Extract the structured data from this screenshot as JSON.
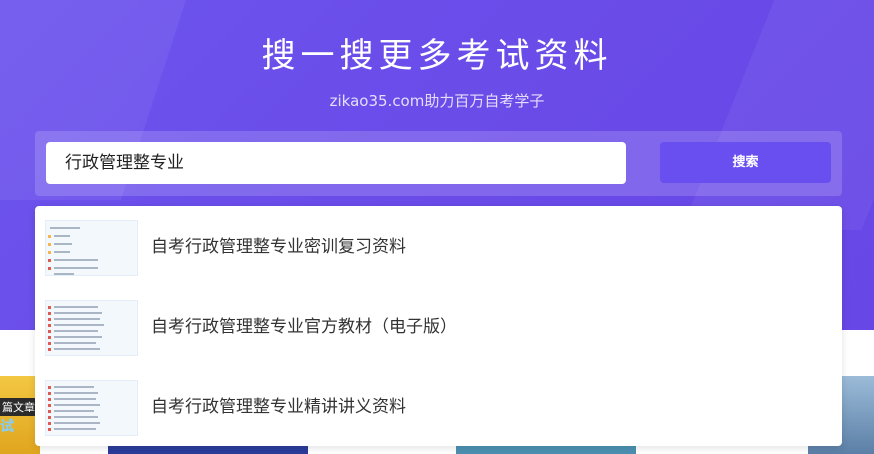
{
  "hero": {
    "title": "搜一搜更多考试资料",
    "subtitle": "zikao35.com助力百万自考学子",
    "background_color": "#6b4eea"
  },
  "search": {
    "query": "行政管理整专业",
    "button_label": "搜索",
    "button_color": "#6a4ff0"
  },
  "suggestions": [
    {
      "label": "自考行政管理整专业密训复习资料",
      "thumbnail": "document-preview"
    },
    {
      "label": "自考行政管理整专业官方教材（电子版）",
      "thumbnail": "file-list-preview"
    },
    {
      "label": "自考行政管理整专业精讲讲义资料",
      "thumbnail": "file-list-preview"
    }
  ],
  "background_strip": {
    "caption": "篇文章",
    "caption2": "试"
  }
}
